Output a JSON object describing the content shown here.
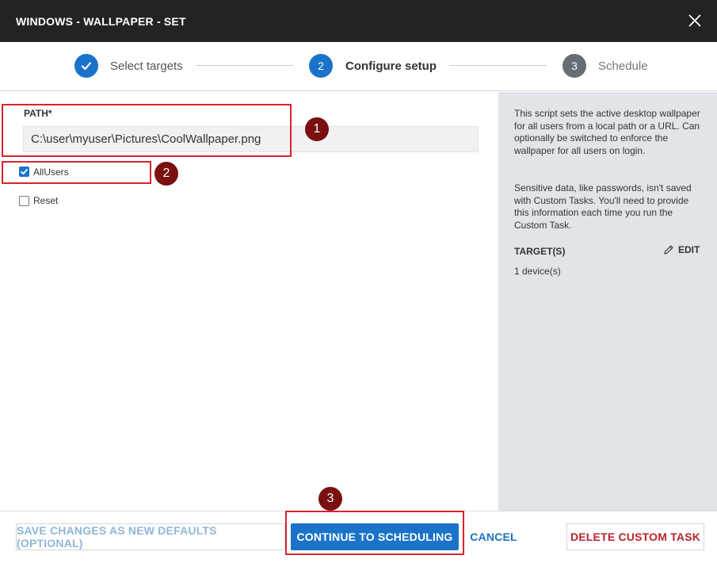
{
  "dialog": {
    "title": "WINDOWS - WALLPAPER - SET"
  },
  "stepper": {
    "steps": [
      {
        "label": "Select targets",
        "state": "complete"
      },
      {
        "number": "2",
        "label": "Configure setup",
        "state": "active"
      },
      {
        "number": "3",
        "label": "Schedule",
        "state": "pending"
      }
    ]
  },
  "form": {
    "path_label": "PATH*",
    "path_value": "C:\\user\\myuser\\Pictures\\CoolWallpaper.png",
    "allusers_label": "AllUsers",
    "allusers_checked": true,
    "reset_label": "Reset",
    "reset_checked": false
  },
  "sidebar": {
    "description": "This script sets the active desktop wallpaper for all users from a local path or a URL. Can optionally be switched to enforce the wallpaper for all users on login.",
    "sensitive_note": "Sensitive data, like passwords, isn't saved with Custom Tasks. You'll need to provide this information each time you run the Custom Task.",
    "targets_title": "TARGET(S)",
    "edit_label": "EDIT",
    "devices_text": "1 device(s)"
  },
  "annotations": {
    "badge1": "1",
    "badge2": "2",
    "badge3": "3"
  },
  "footer": {
    "save_defaults_label": "SAVE CHANGES AS NEW DEFAULTS (OPTIONAL)",
    "continue_label": "CONTINUE TO SCHEDULING",
    "cancel_label": "CANCEL",
    "delete_label": "DELETE CUSTOM TASK"
  },
  "colors": {
    "titlebar": "#222325",
    "accent": "#1a73c8",
    "pending_step": "#666e75",
    "sidebar_bg": "#e1e5ea",
    "highlight": "#d9232d",
    "badge": "#7a1010",
    "danger": "#b8242b"
  },
  "icons": {
    "close": "close-icon",
    "step_complete": "checkmark-icon",
    "edit": "pencil-icon"
  }
}
